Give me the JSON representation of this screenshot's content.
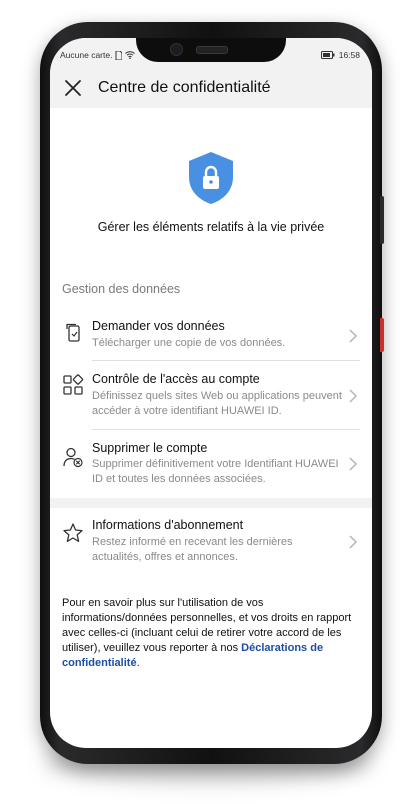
{
  "status_bar": {
    "carrier": "Aucune carte.",
    "time": "16:58"
  },
  "app_bar": {
    "title": "Centre de confidentialité"
  },
  "hero": {
    "text": "Gérer les éléments relatifs à la vie privée"
  },
  "data_section": {
    "heading": "Gestion des données",
    "items": [
      {
        "title": "Demander vos données",
        "subtitle": "Télécharger une copie de vos données."
      },
      {
        "title": "Contrôle de l'accès au compte",
        "subtitle": "Définissez quels sites Web ou applications peuvent accéder à votre identifiant HUAWEI ID."
      },
      {
        "title": "Supprimer le compte",
        "subtitle": "Supprimer définitivement votre Identifiant HUAWEI ID et toutes les données associées."
      }
    ]
  },
  "subscription": {
    "title": "Informations d'abonnement",
    "subtitle": "Restez informé en recevant les dernières actualités, offres et annonces."
  },
  "footer": {
    "text": "Pour en savoir plus sur l'utilisation de vos informations/données personnelles, et vos droits en rapport avec celles-ci (incluant celui de retirer votre accord de les utiliser), veuillez vous reporter à nos ",
    "link": "Déclarations de confidentialité",
    "end": "."
  },
  "colors": {
    "accent_blue": "#4a90e2",
    "link": "#1c4fa0",
    "background_gray": "#f2f2f2"
  }
}
